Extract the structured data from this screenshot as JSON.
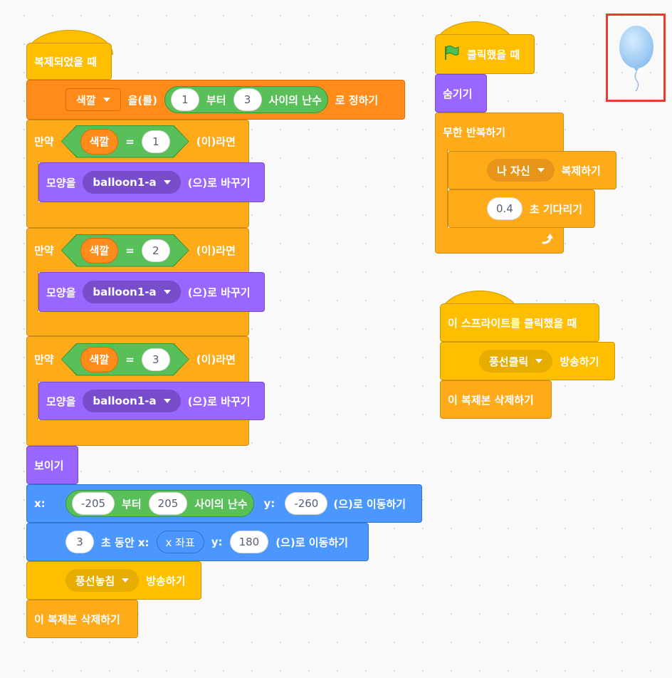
{
  "script1": {
    "hat_label": "복제되었을 때",
    "set_var": {
      "var": "색깔",
      "word1": "을(를)",
      "from": "1",
      "mid": "부터",
      "to": "3",
      "tail": "사이의 난수",
      "end": "로 정하기"
    },
    "if_blocks": [
      {
        "if": "만약",
        "var": "색깔",
        "eq": "=",
        "value": "1",
        "then": "(이)라면",
        "look_label": "모양을",
        "costume": "balloon1-a",
        "look_end": "(으)로 바꾸기"
      },
      {
        "if": "만약",
        "var": "색깔",
        "eq": "=",
        "value": "2",
        "then": "(이)라면",
        "look_label": "모양을",
        "costume": "balloon1-a",
        "look_end": "(으)로 바꾸기"
      },
      {
        "if": "만약",
        "var": "색깔",
        "eq": "=",
        "value": "3",
        "then": "(이)라면",
        "look_label": "모양을",
        "costume": "balloon1-a",
        "look_end": "(으)로 바꾸기"
      }
    ],
    "show": "보이기",
    "goto": {
      "x_label": "x:",
      "from": "-205",
      "mid": "부터",
      "to": "205",
      "tail": "사이의 난수",
      "y_label": "y:",
      "y": "-260",
      "end": "(으)로 이동하기"
    },
    "glide": {
      "secs": "3",
      "label1": "초 동안 x:",
      "x_rep": "x 좌표",
      "y_label": "y:",
      "y": "180",
      "end": "(으)로 이동하기"
    },
    "broadcast": {
      "msg": "풍선놓침",
      "end": "방송하기"
    },
    "delete": "이 복제본 삭제하기"
  },
  "script2": {
    "hat_label": "클릭했을 때",
    "hide": "숨기기",
    "forever": "무한 반복하기",
    "clone": {
      "target": "나 자신",
      "end": "복제하기"
    },
    "wait": {
      "secs": "0.4",
      "end": "초 기다리기"
    }
  },
  "script3": {
    "hat_label": "이 스프라이트를 클릭했을 때",
    "broadcast": {
      "msg": "풍선클릭",
      "end": "방송하기"
    },
    "delete": "이 복제본 삭제하기"
  },
  "colors": {
    "events": "#ffbf00",
    "control": "#ffab19",
    "variables": "#ff8c1a",
    "looks": "#9966ff",
    "motion": "#4c97ff",
    "operators": "#59c059",
    "selection": "#e53c2e"
  }
}
